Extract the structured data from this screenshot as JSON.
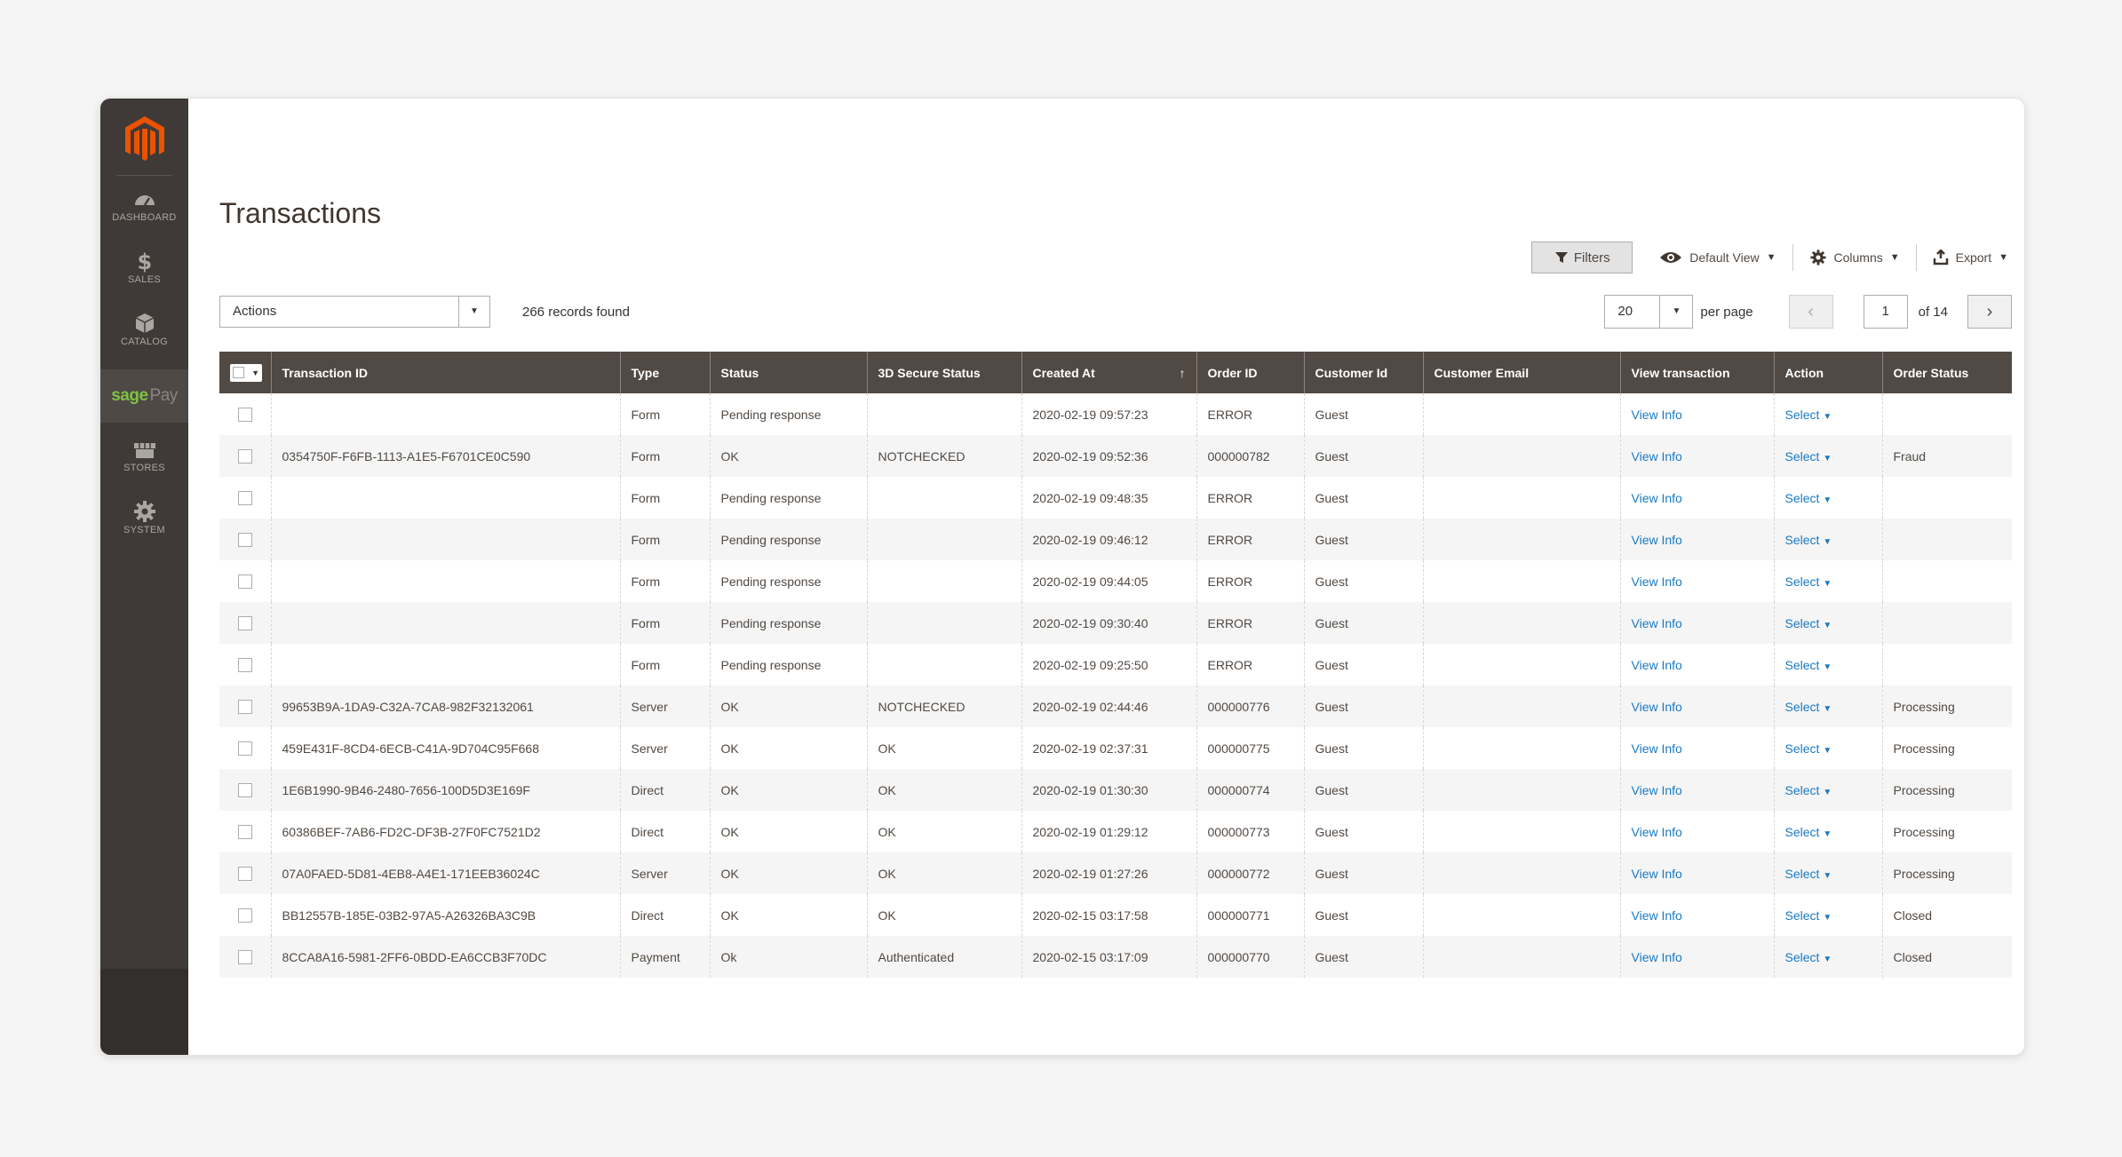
{
  "sidebar": {
    "logo_icon": "magento-logo-icon",
    "items": [
      {
        "label": "DASHBOARD",
        "icon": "dashboard-icon"
      },
      {
        "label": "SALES",
        "icon": "dollar-icon"
      },
      {
        "label": "CATALOG",
        "icon": "cube-icon"
      },
      {
        "label_a": "sage",
        "label_b": "Pay",
        "icon": "sagepay-logo"
      },
      {
        "label": "STORES",
        "icon": "store-icon"
      },
      {
        "label": "SYSTEM",
        "icon": "gear-icon"
      }
    ]
  },
  "page": {
    "title": "Transactions"
  },
  "toolbar": {
    "filters_label": "Filters",
    "view_label": "Default View",
    "columns_label": "Columns",
    "export_label": "Export"
  },
  "actions": {
    "label": "Actions"
  },
  "records_found": "266 records found",
  "pager": {
    "per_page_value": "20",
    "per_page_label": "per page",
    "current_page": "1",
    "of_pages": "of 14"
  },
  "table": {
    "columns": [
      "Transaction ID",
      "Type",
      "Status",
      "3D Secure Status",
      "Created At",
      "Order ID",
      "Customer Id",
      "Customer Email",
      "View transaction",
      "Action",
      "Order Status"
    ],
    "action_label": "Select",
    "rows": [
      {
        "txid": "",
        "type": "Form",
        "status": "Pending response",
        "secure": "",
        "created": "2020-02-19 09:57:23",
        "order": "ERROR",
        "customer": "Guest",
        "email": "",
        "view": "View Info",
        "order_status": ""
      },
      {
        "txid": "0354750F-F6FB-1113-A1E5-F6701CE0C590",
        "type": "Form",
        "status": "OK",
        "secure": "NOTCHECKED",
        "created": "2020-02-19 09:52:36",
        "order": "000000782",
        "customer": "Guest",
        "email": "",
        "view": "View Info",
        "order_status": "Fraud"
      },
      {
        "txid": "",
        "type": "Form",
        "status": "Pending response",
        "secure": "",
        "created": "2020-02-19 09:48:35",
        "order": "ERROR",
        "customer": "Guest",
        "email": "",
        "view": "View Info",
        "order_status": ""
      },
      {
        "txid": "",
        "type": "Form",
        "status": "Pending response",
        "secure": "",
        "created": "2020-02-19 09:46:12",
        "order": "ERROR",
        "customer": "Guest",
        "email": "",
        "view": "View Info",
        "order_status": ""
      },
      {
        "txid": "",
        "type": "Form",
        "status": "Pending response",
        "secure": "",
        "created": "2020-02-19 09:44:05",
        "order": "ERROR",
        "customer": "Guest",
        "email": "",
        "view": "View Info",
        "order_status": ""
      },
      {
        "txid": "",
        "type": "Form",
        "status": "Pending response",
        "secure": "",
        "created": "2020-02-19 09:30:40",
        "order": "ERROR",
        "customer": "Guest",
        "email": "",
        "view": "View Info",
        "order_status": ""
      },
      {
        "txid": "",
        "type": "Form",
        "status": "Pending response",
        "secure": "",
        "created": "2020-02-19 09:25:50",
        "order": "ERROR",
        "customer": "Guest",
        "email": "",
        "view": "View Info",
        "order_status": ""
      },
      {
        "txid": "99653B9A-1DA9-C32A-7CA8-982F32132061",
        "type": "Server",
        "status": "OK",
        "secure": "NOTCHECKED",
        "created": "2020-02-19 02:44:46",
        "order": "000000776",
        "customer": "Guest",
        "email": "",
        "view": "View Info",
        "order_status": "Processing"
      },
      {
        "txid": "459E431F-8CD4-6ECB-C41A-9D704C95F668",
        "type": "Server",
        "status": "OK",
        "secure": "OK",
        "created": "2020-02-19 02:37:31",
        "order": "000000775",
        "customer": "Guest",
        "email": "",
        "view": "View Info",
        "order_status": "Processing"
      },
      {
        "txid": "1E6B1990-9B46-2480-7656-100D5D3E169F",
        "type": "Direct",
        "status": "OK",
        "secure": "OK",
        "created": "2020-02-19 01:30:30",
        "order": "000000774",
        "customer": "Guest",
        "email": "",
        "view": "View Info",
        "order_status": "Processing"
      },
      {
        "txid": "60386BEF-7AB6-FD2C-DF3B-27F0FC7521D2",
        "type": "Direct",
        "status": "OK",
        "secure": "OK",
        "created": "2020-02-19 01:29:12",
        "order": "000000773",
        "customer": "Guest",
        "email": "",
        "view": "View Info",
        "order_status": "Processing"
      },
      {
        "txid": "07A0FAED-5D81-4EB8-A4E1-171EEB36024C",
        "type": "Server",
        "status": "OK",
        "secure": "OK",
        "created": "2020-02-19 01:27:26",
        "order": "000000772",
        "customer": "Guest",
        "email": "",
        "view": "View Info",
        "order_status": "Processing"
      },
      {
        "txid": "BB12557B-185E-03B2-97A5-A26326BA3C9B",
        "type": "Direct",
        "status": "OK",
        "secure": "OK",
        "created": "2020-02-15 03:17:58",
        "order": "000000771",
        "customer": "Guest",
        "email": "",
        "view": "View Info",
        "order_status": "Closed"
      },
      {
        "txid": "8CCA8A16-5981-2FF6-0BDD-EA6CCB3F70DC",
        "type": "Payment",
        "status": "Ok",
        "secure": "Authenticated",
        "created": "2020-02-15 03:17:09",
        "order": "000000770",
        "customer": "Guest",
        "email": "",
        "view": "View Info",
        "order_status": "Closed"
      }
    ]
  },
  "colors": {
    "sidebar_bg": "#3f3a37",
    "header_bg": "#514943",
    "link": "#1979c3",
    "logo": "#eb5202",
    "sage_green": "#7ec243"
  }
}
